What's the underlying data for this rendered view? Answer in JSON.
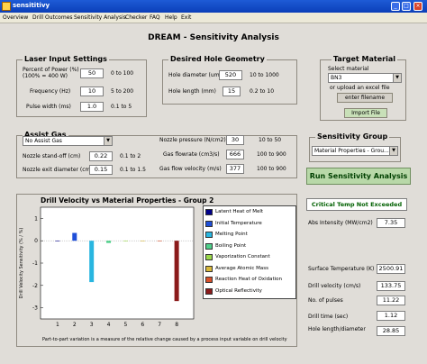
{
  "window": {
    "title": "sensititivy"
  },
  "menu": [
    "Overview",
    "Drill Outcomes",
    "Sensitivity Analysis",
    "Checker",
    "FAQ",
    "Help",
    "Exit"
  ],
  "page_title": "DREAM - Sensitivity Analysis",
  "laser": {
    "title": "Laser Input Settings",
    "rows": [
      {
        "label": "Percent of Power (%)",
        "label2": "(100% = 400 W)",
        "value": "50",
        "range": "0 to 100"
      },
      {
        "label": "Frequency (Hz)",
        "value": "10",
        "range": "5 to 200"
      },
      {
        "label": "Pulse width (ms)",
        "value": "1.0",
        "range": "0.1 to 5"
      }
    ]
  },
  "geometry": {
    "title": "Desired Hole Geometry",
    "rows": [
      {
        "label": "Hole diameter (um)",
        "value": "520",
        "range": "10 to 1000"
      },
      {
        "label": "Hole length (mm)",
        "value": "15",
        "range": "0.2 to 10"
      }
    ]
  },
  "target": {
    "title": "Target Material",
    "select_label": "Select material",
    "selected": "BN3",
    "upload_label": "or upload an excel file",
    "filename": "enter filename",
    "import_label": "Import File"
  },
  "assist": {
    "title": "Assist Gas",
    "selected": "No Assist Gas",
    "rows": [
      {
        "label": "Nozzle stand-off (cm)",
        "value": "0.22",
        "range": "0.1 to 2"
      },
      {
        "label": "Nozzle exit diameter (cm)",
        "value": "0.15",
        "range": "0.1 to 1.5"
      }
    ],
    "rows_right": [
      {
        "label": "Nozzle pressure (N/cm2)",
        "value": "30",
        "range": "10 to 50"
      },
      {
        "label": "Gas flowrate (cm3/s)",
        "value": "666",
        "range": "100 to 900"
      },
      {
        "label": "Gas flow velocity (m/s)",
        "value": "377",
        "range": "100 to 900"
      }
    ]
  },
  "sensitivity": {
    "title": "Sensitivity Group",
    "selected": "Material Properties - Grou..."
  },
  "run_label": "Run Sensitivity Analysis",
  "warning": "Critical Temp Not Exceeded",
  "results": [
    {
      "label": "Abs Intensity (MW/cm2)",
      "value": "7.35"
    },
    {
      "label": "Surface Temperature (K)",
      "value": "2500.91"
    },
    {
      "label": "Drill velocity (cm/s)",
      "value": "133.75"
    },
    {
      "label": "No. of pulses",
      "value": "11.22"
    },
    {
      "label": "Drill time (sec)",
      "value": "1.12"
    },
    {
      "label": "Hole length/diameter",
      "value": "28.85"
    }
  ],
  "chart_data": {
    "type": "bar",
    "title": "Drill Velocity vs Material Properties - Group 2",
    "ylabel": "Drill Velocity Sensitivity (% / %)",
    "xlabel": "Part-to-part variation is a measure of the relative change caused by a process input variable on drill velocity",
    "categories": [
      "1",
      "2",
      "3",
      "4",
      "5",
      "6",
      "7",
      "8"
    ],
    "yticks": [
      "1",
      "0",
      "-1",
      "-2",
      "-3"
    ],
    "ylim": [
      -3.5,
      1.5
    ],
    "values": [
      0.0,
      0.35,
      -1.85,
      -0.1,
      0.0,
      0.0,
      -0.02,
      -2.7
    ],
    "colors": [
      "#00008b",
      "#1f4fd8",
      "#29b6e0",
      "#4fd08a",
      "#9ad84a",
      "#d8b83a",
      "#d8502a",
      "#8b1a1a"
    ],
    "legend": [
      "Latent Heat of Melt",
      "Initial Temperature",
      "Melting Point",
      "Boiling Point",
      "Vaporization Constant",
      "Average Atomic Mass",
      "Reaction Heat of Oxidation",
      "Optical Reflectivity"
    ]
  }
}
